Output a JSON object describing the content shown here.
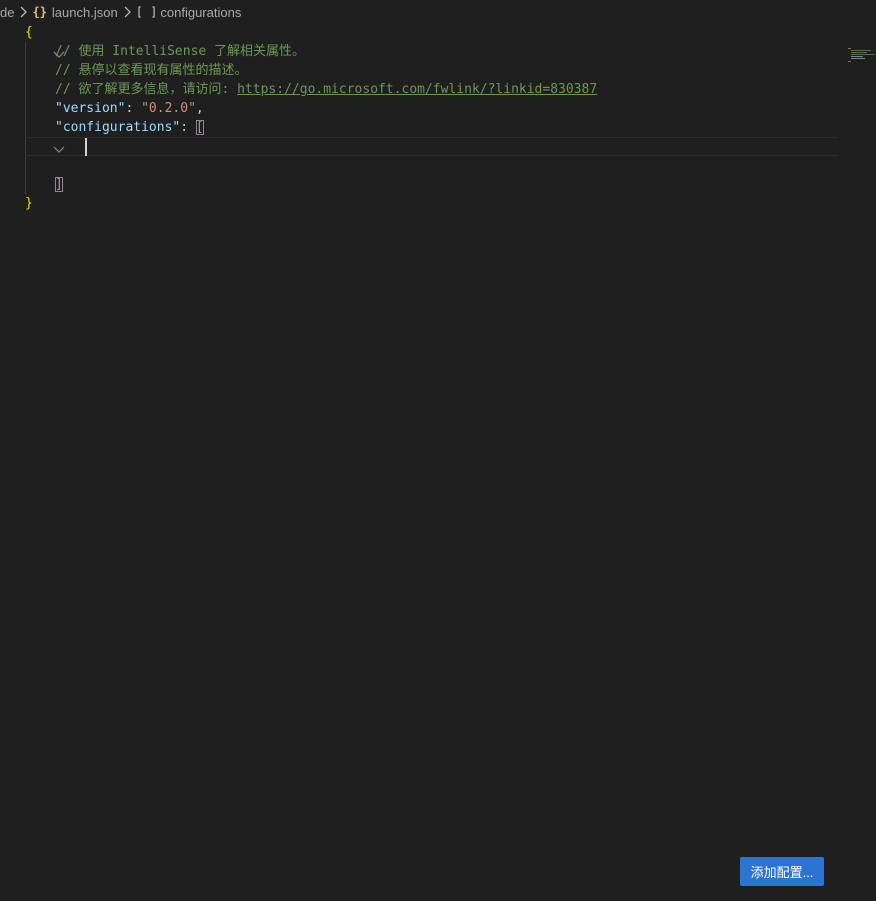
{
  "breadcrumb": {
    "folder": "de",
    "file": "launch.json",
    "symbol": "configurations",
    "file_icon": "{}",
    "symbol_icon": "[ ]"
  },
  "editor": {
    "lines": {
      "l1": {
        "brace": "{"
      },
      "l2": {
        "comment": "// 使用 IntelliSense 了解相关属性。"
      },
      "l3": {
        "comment": "// 悬停以查看现有属性的描述。"
      },
      "l4": {
        "comment": "// 欲了解更多信息，请访问: ",
        "link": "https://go.microsoft.com/fwlink/?linkid=830387"
      },
      "l5": {
        "key": "\"version\"",
        "colon": ": ",
        "value": "\"0.2.0\"",
        "comma": ","
      },
      "l6": {
        "key": "\"configurations\"",
        "colon": ": ",
        "open": "["
      },
      "l9": {
        "close": "]"
      },
      "l10": {
        "brace": "}"
      }
    }
  },
  "button": {
    "add_config": "添加配置..."
  },
  "colors": {
    "background": "#1f1f1f",
    "brace": "#ffd700",
    "comment": "#6a9955",
    "key": "#9cdcfe",
    "string": "#ce9178",
    "bracket": "#da70d6",
    "button": "#2d74d2"
  },
  "icons": {
    "breadcrumb_chevron": "chevron-right-icon",
    "fold": "chevron-down-icon",
    "file": "json-braces-icon",
    "symbol": "array-icon"
  }
}
